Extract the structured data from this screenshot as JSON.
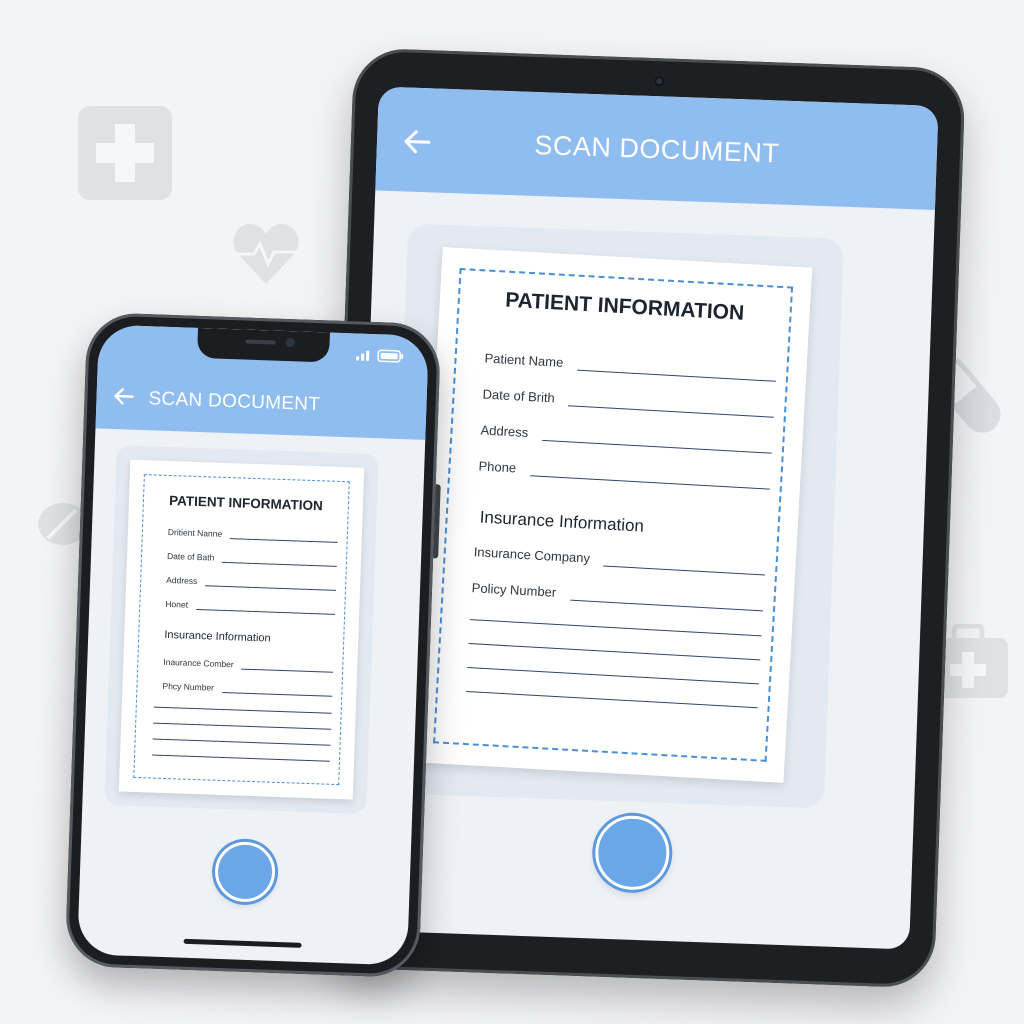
{
  "colors": {
    "background": "#f3f4f6",
    "app_bar": "#8fbdf0",
    "dashed_border": "#4a8fd6",
    "shutter": "#6aa6e8",
    "device_frame": "#1d1f22"
  },
  "background_icons": [
    "medical-cross-icon",
    "heart-pulse-icon",
    "pill-capsule-icon",
    "pill-tablet-icon",
    "first-aid-kit-icon"
  ],
  "tablet": {
    "title": "SCAN DOCUMENT",
    "back_icon": "arrow-left-icon",
    "document": {
      "title": "PATIENT INFORMATION",
      "fields": [
        "Patient Name",
        "Date of Brith",
        "Address",
        "Phone"
      ],
      "section_title": "Insurance Information",
      "section_fields": [
        "Insurance Company",
        "Policy Number"
      ]
    },
    "shutter_icon": "capture-button"
  },
  "phone": {
    "title": "SCAN DOCUMENT",
    "back_icon": "arrow-left-icon",
    "status_icons": [
      "signal-icon",
      "battery-icon"
    ],
    "document": {
      "title": "PATIENT INFORMATION",
      "fields": [
        "Dritient Nanne",
        "Date of Bath",
        "Address",
        "Honet"
      ],
      "section_title": "Insurance Information",
      "section_fields": [
        "Inaurance Comber",
        "Phcy Number"
      ]
    },
    "shutter_icon": "capture-button"
  }
}
